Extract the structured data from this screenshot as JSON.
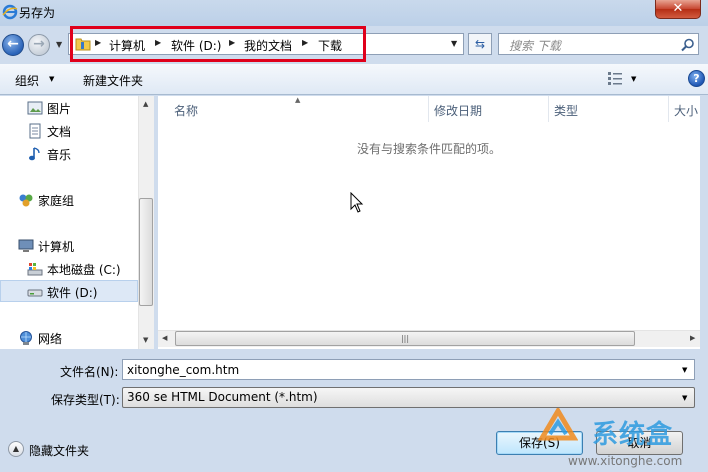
{
  "window": {
    "title": "另存为",
    "close_label": "✕"
  },
  "address": {
    "crumbs": [
      "计算机",
      "软件 (D:)",
      "我的文档",
      "下载"
    ]
  },
  "search": {
    "placeholder": "搜索 下载"
  },
  "toolbar": {
    "organize_label": "组织",
    "new_folder_label": "新建文件夹",
    "help_label": "?"
  },
  "nav_pane": {
    "items": [
      {
        "label": "图片",
        "icon": "pictures-icon"
      },
      {
        "label": "文档",
        "icon": "documents-icon"
      },
      {
        "label": "音乐",
        "icon": "music-icon"
      },
      {
        "label": "家庭组",
        "icon": "homegroup-icon"
      },
      {
        "label": "计算机",
        "icon": "computer-icon"
      },
      {
        "label": "本地磁盘 (C:)",
        "icon": "system-drive-icon"
      },
      {
        "label": "软件 (D:)",
        "icon": "drive-icon",
        "selected": true
      },
      {
        "label": "网络",
        "icon": "network-icon"
      }
    ]
  },
  "file_list": {
    "columns": [
      "名称",
      "修改日期",
      "类型",
      "大小"
    ],
    "empty_message": "没有与搜索条件匹配的项。"
  },
  "form": {
    "filename_label": "文件名(N):",
    "filename_value": "xitonghe_com.htm",
    "savetype_label": "保存类型(T):",
    "savetype_value": "360 se HTML Document (*.htm)"
  },
  "footer": {
    "hide_folders_label": "隐藏文件夹",
    "save_button": "保存(S)",
    "cancel_button": "取消"
  },
  "watermark": {
    "brand": "系统盒",
    "url": "www.xitonghe.com"
  },
  "colors": {
    "highlight_border": "#e0001b",
    "accent": "#2e9be0"
  }
}
